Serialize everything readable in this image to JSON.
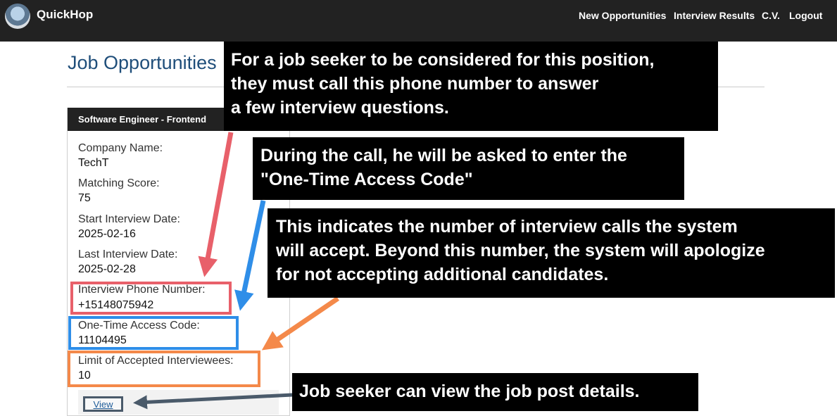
{
  "navbar": {
    "brand": "QuickHop",
    "links": [
      "New Opportunities",
      "Interview Results",
      "C.V.",
      "Logout"
    ]
  },
  "page": {
    "title": "Job Opportunities"
  },
  "card": {
    "header": "Software Engineer - Frontend",
    "fields": [
      {
        "label": "Company Name:",
        "value": "TechT"
      },
      {
        "label": "Matching Score:",
        "value": "75"
      },
      {
        "label": "Start Interview Date:",
        "value": "2025-02-16"
      },
      {
        "label": "Last Interview Date:",
        "value": "2025-02-28"
      },
      {
        "label": "Interview Phone Number:",
        "value": "+15148075942"
      },
      {
        "label": "One-Time Access Code:",
        "value": "11104495"
      },
      {
        "label": "Limit of Accepted Interviewees:",
        "value": "10"
      }
    ],
    "view_label": "View"
  },
  "callouts": {
    "phone": [
      "For a job seeker to be considered for this position,",
      "they must call this phone number to answer",
      "a few interview questions."
    ],
    "code": [
      "During the call, he will be asked to enter the",
      "\"One-Time Access Code\""
    ],
    "limit": [
      "This indicates the number of interview calls the system",
      "will accept. Beyond this number, the system will apologize",
      "for not accepting additional candidates."
    ],
    "view": [
      "Job seeker can view the job  post  details."
    ]
  },
  "colors": {
    "navbar": "#222222",
    "title": "#1f4e7a",
    "highlight_phone": "#e8606a",
    "highlight_code": "#2f8ee8",
    "highlight_limit": "#f4894a",
    "highlight_view": "#4a5a6a"
  },
  "icons": {
    "logo": "handshake-globe-logo"
  }
}
